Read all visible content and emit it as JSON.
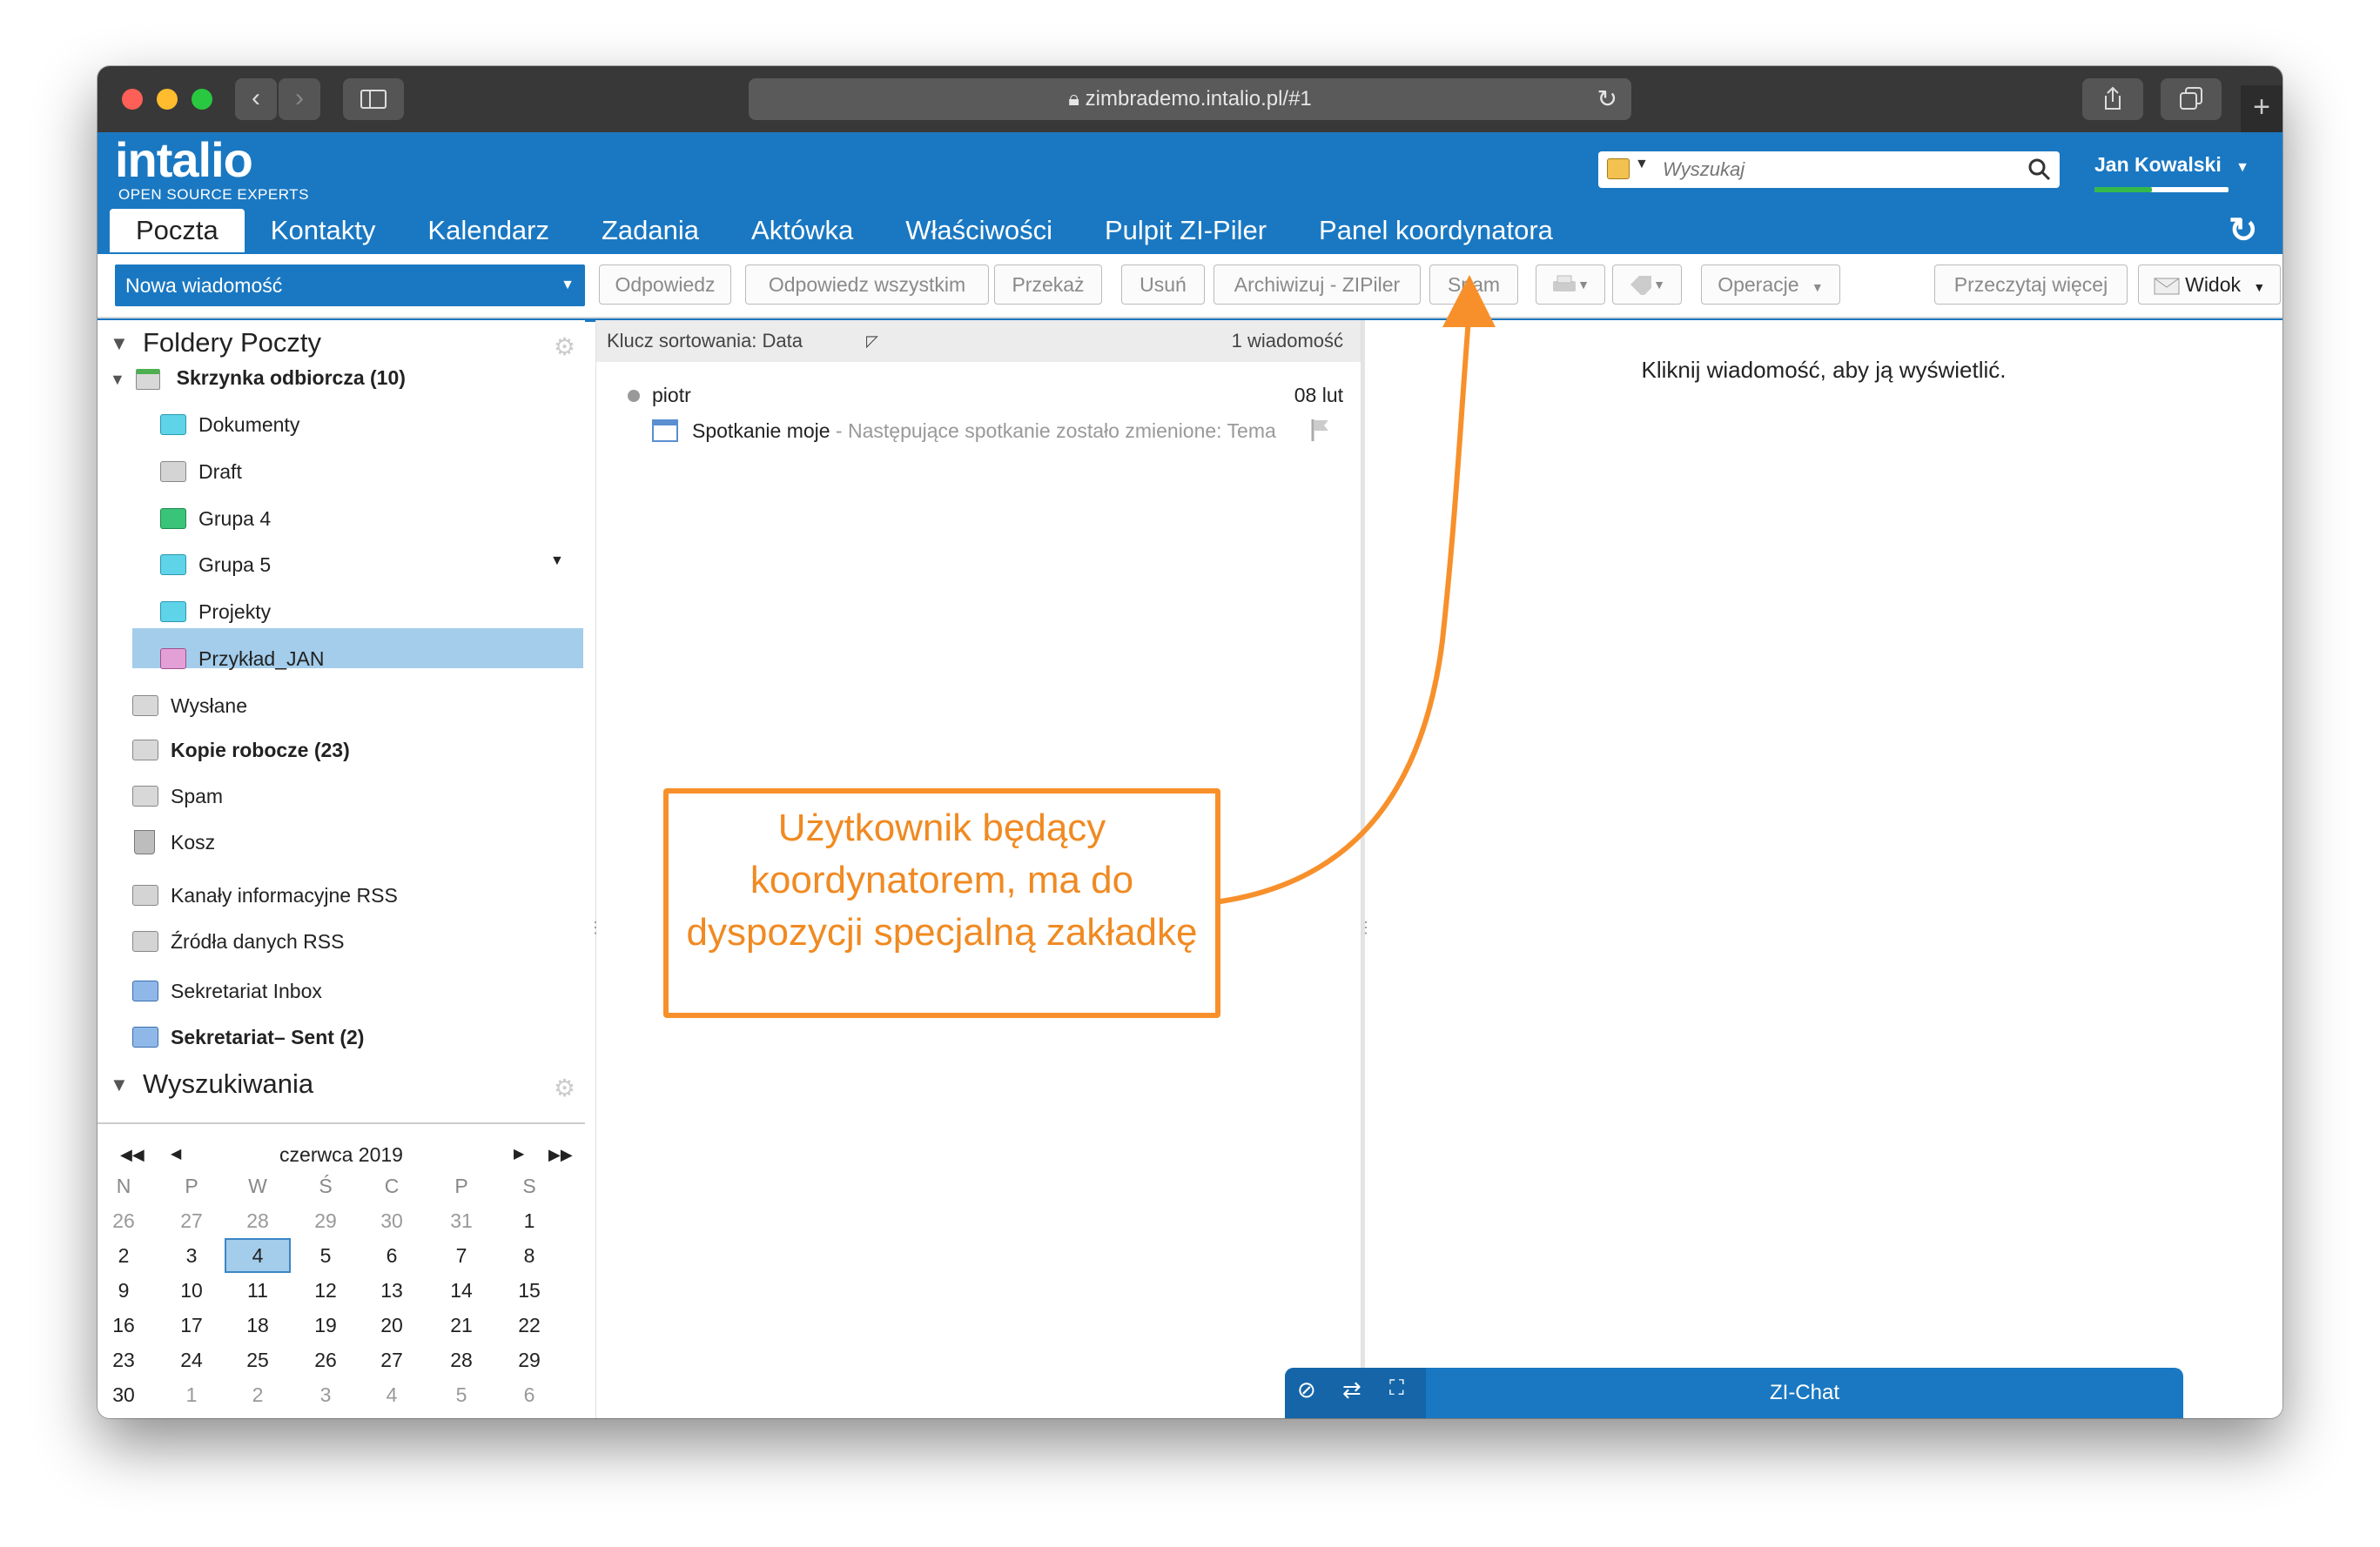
{
  "browser": {
    "url": "zimbrademo.intalio.pl/#1"
  },
  "logo": {
    "name": "intalio",
    "tagline": "OPEN SOURCE EXPERTS"
  },
  "search": {
    "placeholder": "Wyszukaj"
  },
  "user": {
    "name": "Jan Kowalski"
  },
  "tabs": [
    "Poczta",
    "Kontakty",
    "Kalendarz",
    "Zadania",
    "Aktówka",
    "Właściwości",
    "Pulpit ZI-Piler",
    "Panel koordynatora"
  ],
  "toolbar": {
    "new_message": "Nowa wiadomość",
    "reply": "Odpowiedz",
    "reply_all": "Odpowiedz wszystkim",
    "forward": "Przekaż",
    "delete": "Usuń",
    "archive": "Archiwizuj - ZIPiler",
    "spam": "Spam",
    "actions": "Operacje",
    "read_more": "Przeczytaj więcej",
    "view": "Widok"
  },
  "folders": {
    "title": "Foldery Poczty",
    "inbox": "Skrzynka odbiorcza (10)",
    "sub": [
      "Dokumenty",
      "Draft",
      "Grupa 4",
      "Grupa 5",
      "Projekty",
      "Przykład_JAN"
    ],
    "sent": "Wysłane",
    "drafts": "Kopie robocze (23)",
    "spam": "Spam",
    "trash": "Kosz",
    "rss": "Kanały informacyjne RSS",
    "rss_sources": "Źródła danych RSS",
    "shared_inbox": "Sekretariat Inbox",
    "shared_sent": "Sekretariat– Sent (2)"
  },
  "searches": {
    "title": "Wyszukiwania"
  },
  "calendar": {
    "month": "czerwca 2019",
    "days": [
      "N",
      "P",
      "W",
      "Ś",
      "C",
      "P",
      "S"
    ],
    "weeks": [
      [
        "26",
        "27",
        "28",
        "29",
        "30",
        "31",
        "1"
      ],
      [
        "2",
        "3",
        "4",
        "5",
        "6",
        "7",
        "8"
      ],
      [
        "9",
        "10",
        "11",
        "12",
        "13",
        "14",
        "15"
      ],
      [
        "16",
        "17",
        "18",
        "19",
        "20",
        "21",
        "22"
      ],
      [
        "23",
        "24",
        "25",
        "26",
        "27",
        "28",
        "29"
      ],
      [
        "30",
        "1",
        "2",
        "3",
        "4",
        "5",
        "6"
      ]
    ],
    "today": "4"
  },
  "list": {
    "sort": "Klucz sortowania: Data",
    "count": "1 wiadomość",
    "sender": "piotr",
    "date": "08 lut",
    "subject": "Spotkanie moje",
    "preview": " - Następujące spotkanie zostało zmienione: Tema"
  },
  "reading": {
    "hint": "Kliknij wiadomość, aby ją wyświetlić."
  },
  "chat": {
    "label": "ZI-Chat"
  },
  "annotation": {
    "text": "Użytkownik będący koordynatorem, ma do dyspozycji specjalną zakładkę"
  },
  "colors": {
    "brand": "#1a78c2",
    "annotation": "#f7902b",
    "selected": "#a3cdeb"
  }
}
